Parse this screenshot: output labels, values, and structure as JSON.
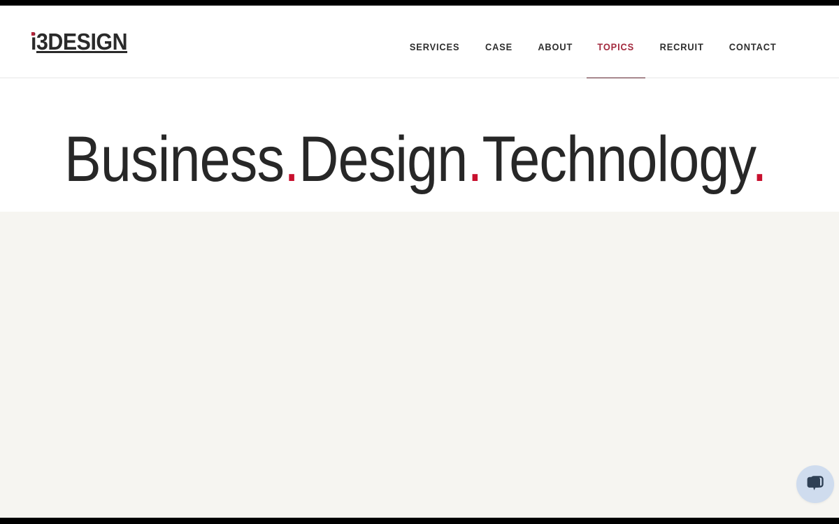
{
  "site": {
    "logo_text": "i3DESIGN",
    "logo_lead_letter": "i",
    "logo_rest": "3DESIGN",
    "brand_accent_color": "#b3243a"
  },
  "header": {
    "nav_items": [
      {
        "label": "SERVICES",
        "active": false
      },
      {
        "label": "CASE",
        "active": false
      },
      {
        "label": "ABOUT",
        "active": false
      },
      {
        "label": "TOPICS",
        "active": true
      },
      {
        "label": "RECRUIT",
        "active": false
      },
      {
        "label": "CONTACT",
        "active": false
      }
    ],
    "active_nav_color": "#a32a3e",
    "nav_text_color": "#2e2e2e",
    "active_underline_color": "#5b2029"
  },
  "hero": {
    "title_parts": [
      {
        "text": "Business",
        "accent": false
      },
      {
        "text": ".",
        "accent": true
      },
      {
        "text": "Design",
        "accent": false
      },
      {
        "text": ".",
        "accent": true
      },
      {
        "text": "Technology",
        "accent": false
      },
      {
        "text": ".",
        "accent": true
      }
    ],
    "title_plain": "Business.Design.Technology.",
    "title_color": "#272727",
    "accent_color": "#c8102e",
    "background_color": "#ffffff"
  },
  "content": {
    "background_color": "#f6f5f1"
  },
  "chat_widget": {
    "icon": "chat-bubbles-icon",
    "background_color": "#cfdcee",
    "icon_color": "#2f4055"
  },
  "chrome": {
    "bar_color": "#000000"
  }
}
